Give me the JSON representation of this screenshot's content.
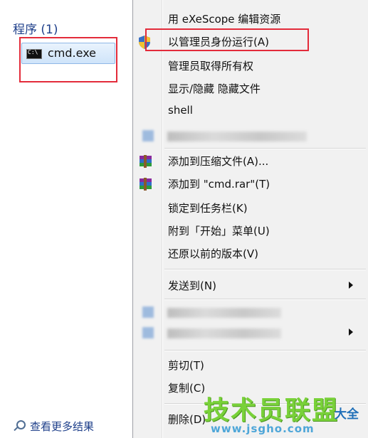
{
  "left_panel": {
    "group_header": "程序 (1)",
    "program_item": "cmd.exe",
    "see_more": "查看更多结果"
  },
  "context_menu": {
    "items": {
      "exescope": "用 eXeScope 编辑资源",
      "run_as_admin": "以管理员身份运行(A)",
      "take_ownership": "管理员取得所有权",
      "show_hide": "显示/隐藏 隐藏文件",
      "shell": "shell",
      "add_to_archive": "添加到压缩文件(A)...",
      "add_to_rar": "添加到 \"cmd.rar\"(T)",
      "pin_taskbar": "锁定到任务栏(K)",
      "pin_start": "附到「开始」菜单(U)",
      "restore_versions": "还原以前的版本(V)",
      "send_to": "发送到(N)",
      "cut": "剪切(T)",
      "copy": "复制(C)",
      "delete": "删除(D)"
    }
  },
  "watermark": {
    "text": "技术员联盟",
    "url": "www.jsgho.com",
    "tail": "大全"
  },
  "colors": {
    "highlight_box": "#e32b3a",
    "link_blue": "#1e3f8a",
    "menu_bg": "#f1f1f1",
    "watermark_green": "#6fcf2a"
  }
}
